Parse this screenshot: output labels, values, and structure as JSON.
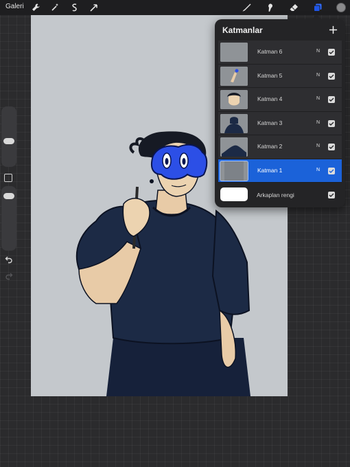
{
  "topbar": {
    "gallery_label": "Galeri",
    "left_icons": [
      "wrench-icon",
      "magic-wand-icon",
      "selection-icon",
      "transform-arrow-icon"
    ],
    "right_icons": [
      "brush-icon",
      "smudge-icon",
      "eraser-icon",
      "layers-icon"
    ],
    "active_tool_accent": "#2f6bff",
    "current_color": "#8a8a8c"
  },
  "layers_panel": {
    "title": "Katmanlar",
    "add_symbol": "+",
    "layers": [
      {
        "name": "Katman 6",
        "blend": "N",
        "visible": true,
        "selected": false
      },
      {
        "name": "Katman 5",
        "blend": "N",
        "visible": true,
        "selected": false
      },
      {
        "name": "Katman 4",
        "blend": "N",
        "visible": true,
        "selected": false
      },
      {
        "name": "Katman 3",
        "blend": "N",
        "visible": true,
        "selected": false
      },
      {
        "name": "Katman 2",
        "blend": "N",
        "visible": true,
        "selected": false
      },
      {
        "name": "Katman 1",
        "blend": "N",
        "visible": true,
        "selected": true
      }
    ],
    "background": {
      "label": "Arkaplan rengi",
      "color": "#ffffff",
      "visible": true
    },
    "selected_color": "#1b62d9"
  },
  "sidebar": {
    "size_slider_value": 0.5,
    "opacity_slider_value": 0.26,
    "icons": [
      "modify-square-icon",
      "undo-icon",
      "redo-icon"
    ]
  },
  "canvas": {
    "background_color": "#c4c8cc",
    "shirt_color": "#1c2a45",
    "mask_color": "#2c4fe6"
  }
}
